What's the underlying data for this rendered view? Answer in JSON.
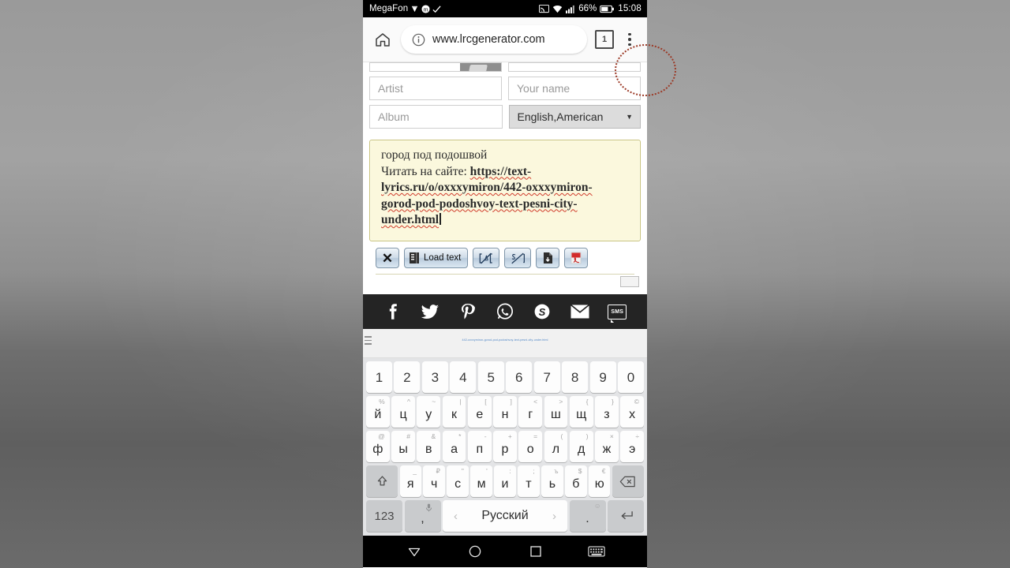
{
  "status_bar": {
    "carrier": "MegaFon",
    "icons_left": [
      "diamond-icon",
      "mts-circle-icon",
      "checkmark-icon"
    ],
    "icons_right": [
      "cast-icon",
      "wifi-icon",
      "signal-icon"
    ],
    "battery_percent": "66%",
    "clock": "15:08"
  },
  "browser": {
    "home_icon": "home-icon",
    "info_icon": "info-icon",
    "url": "www.lrcgenerator.com",
    "tab_count": "1",
    "menu_icon": "kebab-menu-icon"
  },
  "form": {
    "artist_placeholder": "Artist",
    "album_placeholder": "Album",
    "your_name_placeholder": "Your name",
    "language_value": "English,American",
    "language_caret": "▼"
  },
  "lyrics": {
    "line1": "город под подошвой",
    "line2_prefix": "Читать на сайте: ",
    "line2_link": "https://text-",
    "line3": "lyrics.ru/o/oxxxymiron/442-oxxxymiron-",
    "line4": "gorod-pod-podoshvoy-text-pesni-city-",
    "line5": "under.html"
  },
  "toolbar": {
    "clear_label": "✕",
    "load_text_label": "Load text",
    "buttons": [
      {
        "name": "clear-button",
        "icon": "x-icon"
      },
      {
        "name": "load-text-button",
        "icon": "book-icon"
      },
      {
        "name": "insert-tag-open-button",
        "icon": "bracket-slash-icon"
      },
      {
        "name": "insert-tag-close-button",
        "icon": "slash-bracket-icon"
      },
      {
        "name": "save-file-button",
        "icon": "document-download-icon"
      },
      {
        "name": "export-pdf-button",
        "icon": "pdf-icon"
      }
    ]
  },
  "share": {
    "items": [
      {
        "name": "facebook",
        "glyph": "f"
      },
      {
        "name": "twitter",
        "glyph": "t"
      },
      {
        "name": "pinterest",
        "glyph": "P"
      },
      {
        "name": "whatsapp",
        "glyph": "w"
      },
      {
        "name": "skype",
        "glyph": "S"
      },
      {
        "name": "email",
        "glyph": "m"
      },
      {
        "name": "sms",
        "glyph": "SMS"
      }
    ],
    "sms_label": "SMS"
  },
  "strip": {
    "link_text": "442-oxxxymiron-gorod-pod-podoshvoy-text-pesni-city-under.html"
  },
  "keyboard": {
    "row_numbers": [
      "1",
      "2",
      "3",
      "4",
      "5",
      "6",
      "7",
      "8",
      "9",
      "0"
    ],
    "row2": [
      {
        "sup": "%",
        "main": "й"
      },
      {
        "sup": "^",
        "main": "ц"
      },
      {
        "sup": "~",
        "main": "у"
      },
      {
        "sup": "|",
        "main": "к"
      },
      {
        "sup": "[",
        "main": "е"
      },
      {
        "sup": "]",
        "main": "н"
      },
      {
        "sup": "<",
        "main": "г"
      },
      {
        "sup": ">",
        "main": "ш"
      },
      {
        "sup": "{",
        "main": "щ"
      },
      {
        "sup": "}",
        "main": "з"
      },
      {
        "sup": "©",
        "main": "х"
      }
    ],
    "row3": [
      {
        "sup": "@",
        "main": "ф"
      },
      {
        "sup": "#",
        "main": "ы"
      },
      {
        "sup": "&",
        "main": "в"
      },
      {
        "sup": "*",
        "main": "а"
      },
      {
        "sup": "-",
        "main": "п"
      },
      {
        "sup": "+",
        "main": "р"
      },
      {
        "sup": "=",
        "main": "о"
      },
      {
        "sup": "(",
        "main": "л"
      },
      {
        "sup": ")",
        "main": "д"
      },
      {
        "sup": "×",
        "main": "ж"
      },
      {
        "sup": "÷",
        "main": "э"
      }
    ],
    "row4": [
      {
        "sup": "_",
        "main": "я"
      },
      {
        "sup": "₽",
        "main": "ч"
      },
      {
        "sup": "\"",
        "main": "с"
      },
      {
        "sup": "'",
        "main": "м"
      },
      {
        "sup": ":",
        "main": "и"
      },
      {
        "sup": ";",
        "main": "т"
      },
      {
        "sup": "ъ",
        "main": "ь"
      },
      {
        "sup": "$",
        "main": "б"
      },
      {
        "sup": "€",
        "main": "ю"
      }
    ],
    "shift_icon": "shift-icon",
    "backspace_icon": "backspace-icon",
    "numeric_label": "123",
    "comma_label": ",",
    "mic_icon": "microphone-icon",
    "space_label": "Русский",
    "space_prev": "‹",
    "space_next": "›",
    "period_label": ".",
    "emoji_icon": "emoji-icon",
    "enter_icon": "enter-icon"
  },
  "nav_bar": {
    "back_icon": "back-triangle-icon",
    "home_icon": "home-circle-icon",
    "recents_icon": "recents-square-icon",
    "keyboard_icon": "keyboard-icon"
  },
  "annotation": {
    "shape": "dotted-circle-highlight",
    "color": "#9c3b28"
  }
}
